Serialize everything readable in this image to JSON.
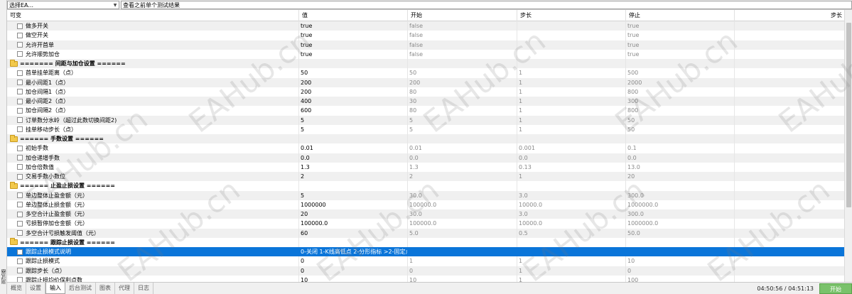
{
  "toolbar": {
    "symbol_combo": "选择EA...",
    "mode_combo": "查看之前单个测试结果"
  },
  "columns": [
    "可变",
    "值",
    "开始",
    "步长",
    "停止",
    "步长"
  ],
  "rows": [
    {
      "type": "param",
      "name": "做多开关",
      "value": "true",
      "start": "false",
      "step": "",
      "stop": "true"
    },
    {
      "type": "param",
      "name": "做空开关",
      "value": "true",
      "start": "false",
      "step": "",
      "stop": "true"
    },
    {
      "type": "param",
      "name": "允许开首单",
      "value": "true",
      "start": "false",
      "step": "",
      "stop": "true"
    },
    {
      "type": "param",
      "name": "允许顺势加仓",
      "value": "true",
      "start": "false",
      "step": "",
      "stop": "true"
    },
    {
      "type": "group",
      "name": "======= 间距与加仓设置 ======"
    },
    {
      "type": "param",
      "name": "首单挂单距离（点）",
      "value": "50",
      "start": "50",
      "step": "1",
      "stop": "500"
    },
    {
      "type": "param",
      "name": "最小间距1（点）",
      "value": "200",
      "start": "200",
      "step": "1",
      "stop": "2000"
    },
    {
      "type": "param",
      "name": "加仓间隔1（点）",
      "value": "200",
      "start": "80",
      "step": "1",
      "stop": "800"
    },
    {
      "type": "param",
      "name": "最小间距2（点）",
      "value": "400",
      "start": "30",
      "step": "1",
      "stop": "300"
    },
    {
      "type": "param",
      "name": "加仓间隔2（点）",
      "value": "600",
      "start": "80",
      "step": "1",
      "stop": "800"
    },
    {
      "type": "param",
      "name": "订单数分水岭（超过此数切换间距2)",
      "value": "5",
      "start": "5",
      "step": "1",
      "stop": "50"
    },
    {
      "type": "param",
      "name": "挂单移动步长（点）",
      "value": "5",
      "start": "5",
      "step": "1",
      "stop": "50"
    },
    {
      "type": "group",
      "name": "====== 手数设置 ======"
    },
    {
      "type": "param",
      "name": "初始手数",
      "value": "0.01",
      "start": "0.01",
      "step": "0.001",
      "stop": "0.1"
    },
    {
      "type": "param",
      "name": "加仓递增手数",
      "value": "0.0",
      "start": "0.0",
      "step": "0.0",
      "stop": "0.0"
    },
    {
      "type": "param",
      "name": "加仓倍数值",
      "value": "1.3",
      "start": "1.3",
      "step": "0.13",
      "stop": "13.0"
    },
    {
      "type": "param",
      "name": "交易手数小数位",
      "value": "2",
      "start": "2",
      "step": "1",
      "stop": "20"
    },
    {
      "type": "group",
      "name": "====== 止盈止损设置 ======"
    },
    {
      "type": "param",
      "name": "单边整体止盈金额（元）",
      "value": "5",
      "start": "30.0",
      "step": "3.0",
      "stop": "300.0"
    },
    {
      "type": "param",
      "name": "单边整体止损金额（元）",
      "value": "1000000",
      "start": "100000.0",
      "step": "10000.0",
      "stop": "1000000.0"
    },
    {
      "type": "param",
      "name": "多空合计止盈金额（元）",
      "value": "20",
      "start": "30.0",
      "step": "3.0",
      "stop": "300.0"
    },
    {
      "type": "param",
      "name": "亏损暂停加仓金额（元）",
      "value": "100000.0",
      "start": "100000.0",
      "step": "10000.0",
      "stop": "1000000.0"
    },
    {
      "type": "param",
      "name": "多空合计亏损触发阈值（元）",
      "value": "60",
      "start": "5.0",
      "step": "0.5",
      "stop": "50.0"
    },
    {
      "type": "group",
      "name": "====== 跟踪止损设置 ======"
    },
    {
      "type": "param",
      "name": "跟踪止损模式说明",
      "value": "0-关闭 1-K线高低点 2-分形指标 >2-固定点数",
      "start": "",
      "step": "",
      "stop": "",
      "selected": true
    },
    {
      "type": "param",
      "name": "跟踪止损模式",
      "value": "0",
      "start": "1",
      "step": "1",
      "stop": "10"
    },
    {
      "type": "param",
      "name": "跟踪步长（点）",
      "value": "0",
      "start": "0",
      "step": "1",
      "stop": "0"
    },
    {
      "type": "param",
      "name": "跟踪止损均价保利点数",
      "value": "10",
      "start": "10",
      "step": "1",
      "stop": "100"
    }
  ],
  "tabs": [
    {
      "label": "概览",
      "active": false
    },
    {
      "label": "设置",
      "active": false
    },
    {
      "label": "输入",
      "active": true
    },
    {
      "label": "后台测试",
      "active": false
    },
    {
      "label": "图表",
      "active": false
    },
    {
      "label": "代理",
      "active": false
    },
    {
      "label": "日志",
      "active": false
    }
  ],
  "status": {
    "timer": "04:50:56 / 04:51:13",
    "start_button": "开始"
  },
  "side_label": "测试器",
  "watermark": "EAHub.cn"
}
